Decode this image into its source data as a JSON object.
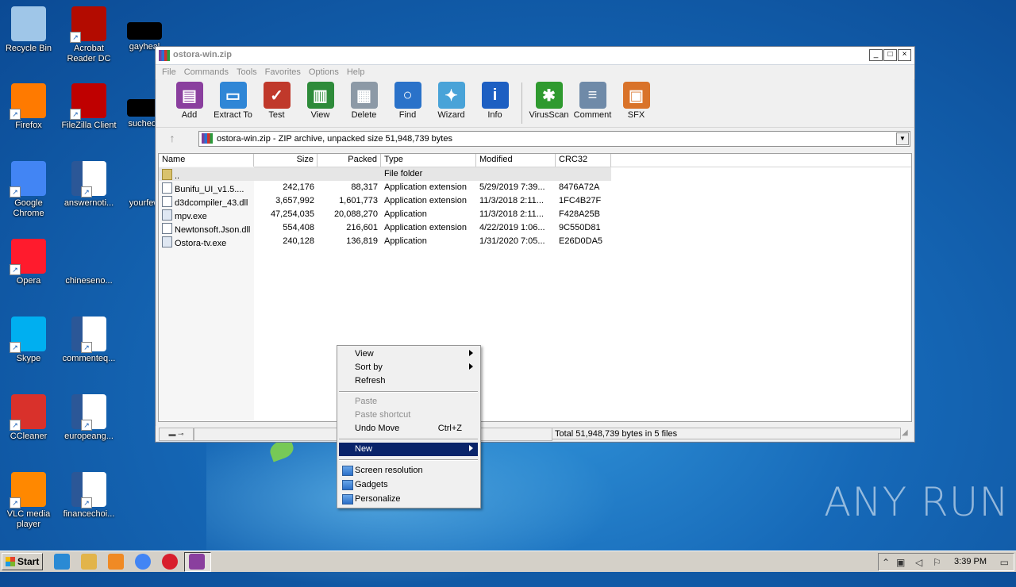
{
  "desktop": {
    "icons": [
      {
        "label": "Recycle Bin",
        "icon": "recycle-bin-icon",
        "color": "#9fc6e8"
      },
      {
        "label": "Acrobat Reader DC",
        "icon": "acrobat-icon",
        "color": "#b30b00"
      },
      {
        "label": "gayheal",
        "icon": "document-icon",
        "color": "#000000"
      },
      {
        "label": "Firefox",
        "icon": "firefox-icon",
        "color": "#ff7a00"
      },
      {
        "label": "FileZilla Client",
        "icon": "filezilla-icon",
        "color": "#bf0000"
      },
      {
        "label": "suchedit",
        "icon": "document-icon",
        "color": "#000000"
      },
      {
        "label": "Google Chrome",
        "icon": "chrome-icon",
        "color": "#4285f4"
      },
      {
        "label": "answernoti...",
        "icon": "word-doc-icon",
        "color": "#2b5797"
      },
      {
        "label": "yourfew",
        "icon": "document-icon",
        "color": "#1669b8"
      },
      {
        "label": "Opera",
        "icon": "opera-icon",
        "color": "#ff1b2d"
      },
      {
        "label": "chineseno...",
        "icon": "document-icon",
        "color": "#1669b8"
      },
      {
        "label": "Skype",
        "icon": "skype-icon",
        "color": "#00aff0"
      },
      {
        "label": "commenteq...",
        "icon": "word-doc-icon",
        "color": "#2b5797"
      },
      {
        "label": "CCleaner",
        "icon": "ccleaner-icon",
        "color": "#d9312b"
      },
      {
        "label": "europeang...",
        "icon": "word-doc-icon",
        "color": "#2b5797"
      },
      {
        "label": "VLC media player",
        "icon": "vlc-icon",
        "color": "#ff8800"
      },
      {
        "label": "financechoi...",
        "icon": "word-doc-icon",
        "color": "#2b5797"
      }
    ]
  },
  "window": {
    "title": "ostora-win.zip",
    "controls": {
      "minimize": "_",
      "maximize": "□",
      "close": "×"
    },
    "menu": [
      "File",
      "Commands",
      "Tools",
      "Favorites",
      "Options",
      "Help"
    ],
    "toolbar": [
      {
        "label": "Add",
        "icon": "add-archive-icon",
        "color": "#8a3f9e",
        "glyph": "▤"
      },
      {
        "label": "Extract To",
        "icon": "extract-folder-icon",
        "color": "#2f86d6",
        "glyph": "▭"
      },
      {
        "label": "Test",
        "icon": "test-clipboard-icon",
        "color": "#c0392b",
        "glyph": "✓"
      },
      {
        "label": "View",
        "icon": "view-book-icon",
        "color": "#2e8b3a",
        "glyph": "▥"
      },
      {
        "label": "Delete",
        "icon": "delete-trash-icon",
        "color": "#8c99a6",
        "glyph": "▦"
      },
      {
        "label": "Find",
        "icon": "find-magnifier-icon",
        "color": "#2a72c9",
        "glyph": "○"
      },
      {
        "label": "Wizard",
        "icon": "wizard-wand-icon",
        "color": "#49a3d8",
        "glyph": "✦"
      },
      {
        "label": "Info",
        "icon": "info-icon",
        "color": "#1d5fc2",
        "glyph": "i"
      },
      {
        "label": "VirusScan",
        "icon": "virus-scan-icon",
        "color": "#2f9a2f",
        "glyph": "✱"
      },
      {
        "label": "Comment",
        "icon": "comment-icon",
        "color": "#6f8aa8",
        "glyph": "≡"
      },
      {
        "label": "SFX",
        "icon": "sfx-icon",
        "color": "#d9732a",
        "glyph": "▣"
      }
    ],
    "address": "ostora-win.zip - ZIP archive, unpacked size 51,948,739 bytes",
    "columns": [
      "Name",
      "Size",
      "Packed",
      "Type",
      "Modified",
      "CRC32"
    ],
    "files": [
      {
        "name": "..",
        "size": "",
        "packed": "",
        "type": "File folder",
        "modified": "",
        "crc": "",
        "kind": "folder"
      },
      {
        "name": "Bunifu_UI_v1.5....",
        "size": "242,176",
        "packed": "88,317",
        "type": "Application extension",
        "modified": "5/29/2019 7:39...",
        "crc": "8476A72A",
        "kind": "dll"
      },
      {
        "name": "d3dcompiler_43.dll",
        "size": "3,657,992",
        "packed": "1,601,773",
        "type": "Application extension",
        "modified": "11/3/2018 2:11...",
        "crc": "1FC4B27F",
        "kind": "dll"
      },
      {
        "name": "mpv.exe",
        "size": "47,254,035",
        "packed": "20,088,270",
        "type": "Application",
        "modified": "11/3/2018 2:11...",
        "crc": "F428A25B",
        "kind": "exe"
      },
      {
        "name": "Newtonsoft.Json.dll",
        "size": "554,408",
        "packed": "216,601",
        "type": "Application extension",
        "modified": "4/22/2019 1:06...",
        "crc": "9C550D81",
        "kind": "dll"
      },
      {
        "name": "Ostora-tv.exe",
        "size": "240,128",
        "packed": "136,819",
        "type": "Application",
        "modified": "1/31/2020 7:05...",
        "crc": "E26D0DA5",
        "kind": "exe"
      }
    ],
    "status": "Total 51,948,739 bytes in 5 files"
  },
  "context_menu": {
    "view": "View",
    "sort_by": "Sort by",
    "refresh": "Refresh",
    "paste": "Paste",
    "paste_shortcut": "Paste shortcut",
    "undo_move": "Undo Move",
    "undo_shortcut": "Ctrl+Z",
    "new": "New",
    "screen_resolution": "Screen resolution",
    "gadgets": "Gadgets",
    "personalize": "Personalize"
  },
  "taskbar": {
    "start": "Start",
    "clock": "3:39 PM",
    "pinned": [
      {
        "icon": "ie-icon",
        "color": "#2a8ad4"
      },
      {
        "icon": "explorer-icon",
        "color": "#e2b44a"
      },
      {
        "icon": "media-player-icon",
        "color": "#f08a24"
      },
      {
        "icon": "chrome-icon",
        "color": "#4285f4"
      },
      {
        "icon": "opera-icon",
        "color": "#d81e2c"
      },
      {
        "icon": "winrar-icon",
        "color": "#8a3f9e"
      }
    ]
  },
  "watermark": "ANY RUN"
}
